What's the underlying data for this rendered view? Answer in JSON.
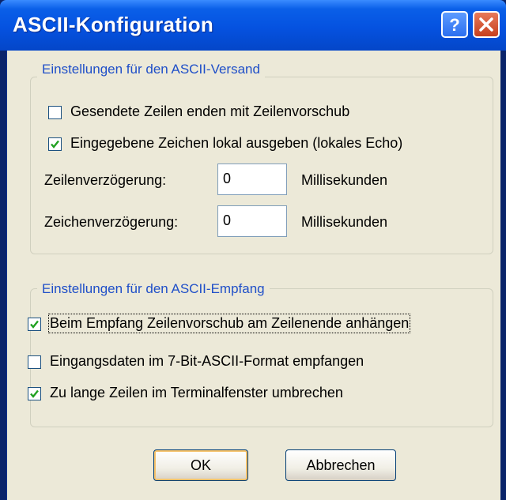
{
  "window": {
    "title": "ASCII-Konfiguration"
  },
  "send_group": {
    "legend": "Einstellungen für den ASCII-Versand",
    "checkbox_linefeed": {
      "label": "Gesendete Zeilen enden mit Zeilenvorschub",
      "checked": false
    },
    "checkbox_echo": {
      "label": "Eingegebene Zeichen lokal ausgeben (lokales Echo)",
      "checked": true
    },
    "line_delay": {
      "label": "Zeilenverzögerung:",
      "value": "0",
      "unit": "Millisekunden"
    },
    "char_delay": {
      "label": "Zeichenverzögerung:",
      "value": "0",
      "unit": "Millisekunden"
    }
  },
  "receive_group": {
    "legend": "Einstellungen für den ASCII-Empfang",
    "checkbox_append_lf": {
      "label": "Beim Empfang Zeilenvorschub am Zeilenende anhängen",
      "checked": true
    },
    "checkbox_7bit": {
      "label": "Eingangsdaten im 7-Bit-ASCII-Format empfangen",
      "checked": false
    },
    "checkbox_wrap": {
      "label": "Zu lange Zeilen im Terminalfenster umbrechen",
      "checked": true
    }
  },
  "buttons": {
    "ok": "OK",
    "cancel": "Abbrechen"
  }
}
